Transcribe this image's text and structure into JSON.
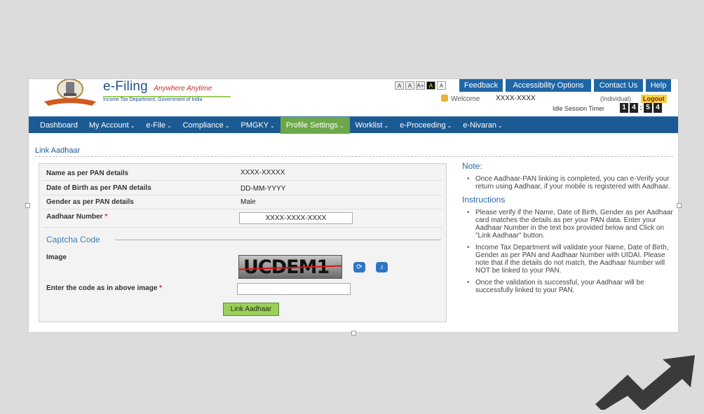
{
  "header": {
    "brand": "e-Filing",
    "tagline": "Anywhere Anytime",
    "dept": "Income Tax Department, Government of India",
    "font_buttons": [
      "A",
      "A",
      "A+",
      "A",
      "A"
    ],
    "top_buttons": [
      "Feedback",
      "Accessibility Options",
      "Contact Us",
      "Help"
    ],
    "welcome": "Welcome",
    "username": "XXXX-XXXX",
    "usertype": "(Individual)",
    "logout": "Logout",
    "idle_label": "Idle Session Timer",
    "timer": [
      "1",
      "4",
      "5",
      "4"
    ]
  },
  "nav": {
    "items": [
      {
        "label": "Dashboard",
        "caret": ""
      },
      {
        "label": "My Account",
        "caret": "⌄"
      },
      {
        "label": "e-File",
        "caret": "⌄"
      },
      {
        "label": "Compliance",
        "caret": "⌄"
      },
      {
        "label": "PMGKY",
        "caret": "⌄"
      },
      {
        "label": "Profile Settings",
        "caret": "⌄"
      },
      {
        "label": "Worklist",
        "caret": "⌄"
      },
      {
        "label": "e-Proceeding",
        "caret": "⌄"
      },
      {
        "label": "e-Nivaran",
        "caret": "⌄"
      }
    ],
    "active_index": 5
  },
  "page": {
    "title": "Link Aadhaar",
    "form": {
      "name_label": "Name as per PAN details",
      "name_value": "XXXX-XXXXX",
      "dob_label": "Date of Birth as per PAN details",
      "dob_value": "DD-MM-YYYY",
      "gender_label": "Gender as per PAN details",
      "gender_value": "Male",
      "aadhaar_label": "Aadhaar Number",
      "aadhaar_value": "XXXX-XXXX-XXXX",
      "required_mark": "*",
      "captcha_heading": "Captcha Code",
      "image_label": "Image",
      "captcha_text": "UCDEM1",
      "code_label": "Enter the code as in above image",
      "code_value": "",
      "submit": "Link Aadhaar"
    },
    "note_heading": "Note:",
    "notes": [
      "Once Aadhaar-PAN linking is completed, you can e-Verify your return using Aadhaar, if your mobile is registered with Aadhaar."
    ],
    "instructions_heading": "Instructions",
    "instructions": [
      "Please verify if the Name, Date of Birth, Gender as per Aadhaar card matches the details as per your PAN data. Enter your Aadhaar Number in the text box provided below and Click on \"Link Aadhaar\" button.",
      "Income Tax Department will validate your Name, Date of Birth, Gender as per PAN and Aadhaar Number with UIDAI. Please note that if the details do not match, the Aadhaar Number will NOT be linked to your PAN.",
      "Once the validation is successful, your Aadhaar will be successfully linked to your PAN."
    ]
  },
  "colors": {
    "nav_bg": "#1c5a93",
    "nav_active": "#6ca84a",
    "button_blue": "#1f66a6",
    "submit_green": "#9bcf5a",
    "page_bg": "#dcdcdc"
  }
}
